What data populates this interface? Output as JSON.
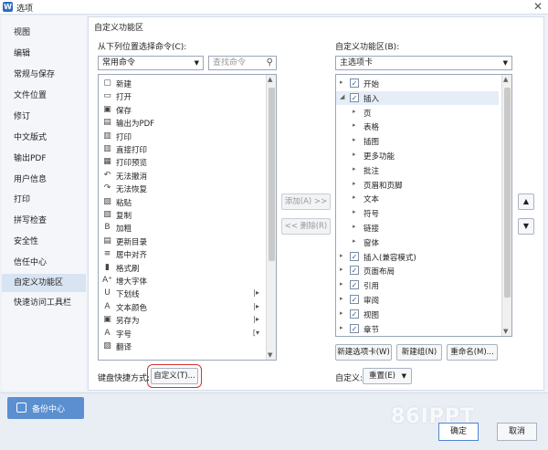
{
  "window": {
    "title": "选项",
    "logo": "W",
    "close_glyph": "✕"
  },
  "sidebar": {
    "items": [
      {
        "label": "视图"
      },
      {
        "label": "编辑"
      },
      {
        "label": "常规与保存"
      },
      {
        "label": "文件位置"
      },
      {
        "label": "修订"
      },
      {
        "label": "中文版式"
      },
      {
        "label": "输出PDF"
      },
      {
        "label": "用户信息"
      },
      {
        "label": "打印"
      },
      {
        "label": "拼写检查"
      },
      {
        "label": "安全性"
      },
      {
        "label": "信任中心"
      },
      {
        "label": "自定义功能区",
        "active": true
      },
      {
        "label": "快速访问工具栏"
      }
    ],
    "backup_label": "备份中心"
  },
  "panel": {
    "group_title": "自定义功能区",
    "left_label": "从下列位置选择命令(C):",
    "left_combo": "常用命令",
    "search_placeholder": "查找命令",
    "right_label": "自定义功能区(B):",
    "right_combo": "主选项卡",
    "commands": [
      {
        "label": "新建",
        "icon": "new-doc-icon",
        "glyph": "▢"
      },
      {
        "label": "打开",
        "icon": "folder-icon",
        "glyph": "▭"
      },
      {
        "label": "保存",
        "icon": "save-icon",
        "glyph": "▣"
      },
      {
        "label": "输出为PDF",
        "icon": "pdf-icon",
        "glyph": "▤"
      },
      {
        "label": "打印",
        "icon": "printer-icon",
        "glyph": "▥"
      },
      {
        "label": "直接打印",
        "icon": "quick-print-icon",
        "glyph": "▥"
      },
      {
        "label": "打印预览",
        "icon": "print-preview-icon",
        "glyph": "▦"
      },
      {
        "label": "无法撤消",
        "icon": "undo-icon",
        "glyph": "↶"
      },
      {
        "label": "无法恢复",
        "icon": "redo-icon",
        "glyph": "↷"
      },
      {
        "label": "粘贴",
        "icon": "paste-icon",
        "glyph": "▨"
      },
      {
        "label": "复制",
        "icon": "copy-icon",
        "glyph": "▧"
      },
      {
        "label": "加粗",
        "icon": "bold-icon",
        "glyph": "B"
      },
      {
        "label": "更新目录",
        "icon": "update-toc-icon",
        "glyph": "▤"
      },
      {
        "label": "居中对齐",
        "icon": "align-center-icon",
        "glyph": "≡"
      },
      {
        "label": "格式刷",
        "icon": "format-painter-icon",
        "glyph": "▮"
      },
      {
        "label": "增大字体",
        "icon": "grow-font-icon",
        "glyph": "A⁺"
      },
      {
        "label": "下划线",
        "icon": "underline-icon",
        "glyph": "U",
        "sub": "|▸"
      },
      {
        "label": "文本颜色",
        "icon": "font-color-icon",
        "glyph": "A",
        "sub": "|▸"
      },
      {
        "label": "另存为",
        "icon": "save-as-icon",
        "glyph": "▣",
        "sub": "|▸"
      },
      {
        "label": "字号",
        "icon": "font-size-icon",
        "glyph": "A",
        "sub": "[▾"
      },
      {
        "label": "翻译",
        "icon": "translate-icon",
        "glyph": "▨"
      }
    ],
    "tree": [
      {
        "label": "开始",
        "level": 0,
        "expander": "▸",
        "checked": true
      },
      {
        "label": "插入",
        "level": 0,
        "expander": "◢",
        "checked": true,
        "selected": true
      },
      {
        "label": "页",
        "level": 1,
        "expander": "▸"
      },
      {
        "label": "表格",
        "level": 1,
        "expander": "▸"
      },
      {
        "label": "插图",
        "level": 1,
        "expander": "▸"
      },
      {
        "label": "更多功能",
        "level": 1,
        "expander": "▸"
      },
      {
        "label": "批注",
        "level": 1,
        "expander": "▸"
      },
      {
        "label": "页眉和页脚",
        "level": 1,
        "expander": "▸"
      },
      {
        "label": "文本",
        "level": 1,
        "expander": "▸"
      },
      {
        "label": "符号",
        "level": 1,
        "expander": "▸"
      },
      {
        "label": "链接",
        "level": 1,
        "expander": "▸"
      },
      {
        "label": "窗体",
        "level": 1,
        "expander": "▸"
      },
      {
        "label": "插入(兼容模式)",
        "level": 0,
        "expander": "▸",
        "checked": true
      },
      {
        "label": "页面布局",
        "level": 0,
        "expander": "▸",
        "checked": true
      },
      {
        "label": "引用",
        "level": 0,
        "expander": "▸",
        "checked": true
      },
      {
        "label": "审阅",
        "level": 0,
        "expander": "▸",
        "checked": true
      },
      {
        "label": "视图",
        "level": 0,
        "expander": "▸",
        "checked": true
      },
      {
        "label": "章节",
        "level": 0,
        "expander": "▸",
        "checked": true
      }
    ],
    "add_label": "添加(A) >>",
    "remove_label": "<< 删除(R)",
    "new_tab_label": "新建选项卡(W)",
    "new_group_label": "新建组(N)",
    "rename_label": "重命名(M)...",
    "shortcut_label": "键盘快捷方式:",
    "customize_btn": "自定义(T)...",
    "customize_label": "自定义:",
    "reset_btn": "重置(E)",
    "move_up_glyph": "▲",
    "move_down_glyph": "▼"
  },
  "footer": {
    "ok_label": "确定",
    "cancel_label": "取消",
    "watermark": "86IPPT"
  }
}
